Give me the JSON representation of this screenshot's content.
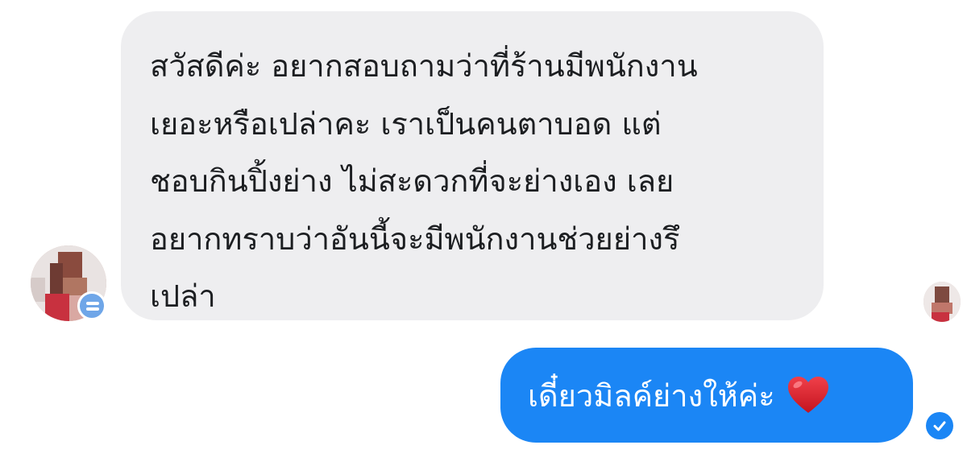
{
  "conversation": {
    "incoming_message": {
      "lines": [
        "สวัสดีค่ะ อยากสอบถามว่าที่ร้านมีพนักงาน",
        "เยอะหรือเปล่าคะ เราเป็นคนตาบอด แต่",
        "ชอบกินปิ้งย่าง ไม่สะดวกที่จะย่างเอง เลย",
        "อยากทราบว่าอันนี้จะมีพนักงานช่วยย่างรึ",
        "เปล่า"
      ]
    },
    "outgoing_message": {
      "text": "เดี๋ยวมิลค์ย่างให้ค่ะ",
      "emoji": "heart-icon"
    }
  },
  "colors": {
    "incoming_bubble": "#eeeef0",
    "incoming_text": "#1c1e21",
    "outgoing_bubble": "#1b86f5",
    "outgoing_text": "#ffffff",
    "heart": "#e0212b"
  },
  "icons": {
    "sender_avatar": "avatar-icon",
    "badge": "messenger-badge-icon",
    "seen": "seen-avatar-icon",
    "delivered": "check-circle-icon"
  }
}
